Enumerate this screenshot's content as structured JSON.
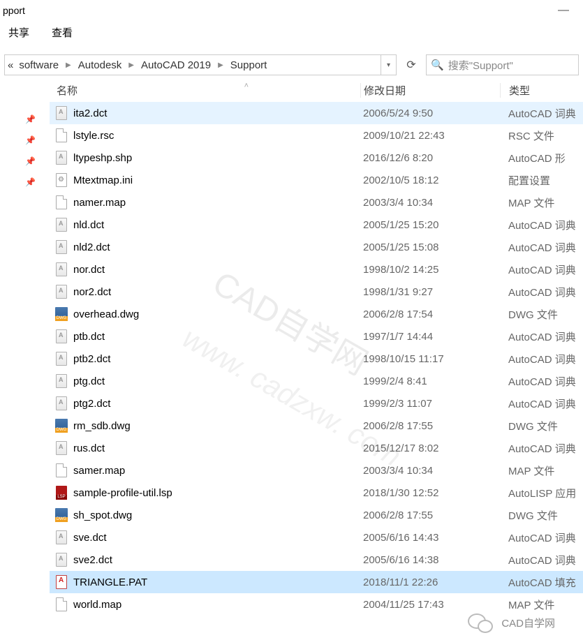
{
  "title_fragment": "pport",
  "toolbar": {
    "share": "共享",
    "view": "查看"
  },
  "breadcrumb": {
    "segs": [
      "software",
      "Autodesk",
      "AutoCAD 2019",
      "Support"
    ]
  },
  "search": {
    "placeholder": "搜索\"Support\""
  },
  "columns": {
    "name": "名称",
    "date": "修改日期",
    "type": "类型"
  },
  "files": [
    {
      "name": "ita2.dct",
      "date": "2006/5/24 9:50",
      "type": "AutoCAD 词典",
      "ico": "dct",
      "sel": "highlight"
    },
    {
      "name": "lstyle.rsc",
      "date": "2009/10/21 22:43",
      "type": "RSC 文件",
      "ico": "blank"
    },
    {
      "name": "ltypeshp.shp",
      "date": "2016/12/6 8:20",
      "type": "AutoCAD 形",
      "ico": "dct"
    },
    {
      "name": "Mtextmap.ini",
      "date": "2002/10/5 18:12",
      "type": "配置设置",
      "ico": "ini"
    },
    {
      "name": "namer.map",
      "date": "2003/3/4 10:34",
      "type": "MAP 文件",
      "ico": "blank"
    },
    {
      "name": "nld.dct",
      "date": "2005/1/25 15:20",
      "type": "AutoCAD 词典",
      "ico": "dct"
    },
    {
      "name": "nld2.dct",
      "date": "2005/1/25 15:08",
      "type": "AutoCAD 词典",
      "ico": "dct"
    },
    {
      "name": "nor.dct",
      "date": "1998/10/2 14:25",
      "type": "AutoCAD 词典",
      "ico": "dct"
    },
    {
      "name": "nor2.dct",
      "date": "1998/1/31 9:27",
      "type": "AutoCAD 词典",
      "ico": "dct"
    },
    {
      "name": "overhead.dwg",
      "date": "2006/2/8 17:54",
      "type": "DWG 文件",
      "ico": "dwg"
    },
    {
      "name": "ptb.dct",
      "date": "1997/1/7 14:44",
      "type": "AutoCAD 词典",
      "ico": "dct"
    },
    {
      "name": "ptb2.dct",
      "date": "1998/10/15 11:17",
      "type": "AutoCAD 词典",
      "ico": "dct"
    },
    {
      "name": "ptg.dct",
      "date": "1999/2/4 8:41",
      "type": "AutoCAD 词典",
      "ico": "dct"
    },
    {
      "name": "ptg2.dct",
      "date": "1999/2/3 11:07",
      "type": "AutoCAD 词典",
      "ico": "dct"
    },
    {
      "name": "rm_sdb.dwg",
      "date": "2006/2/8 17:55",
      "type": "DWG 文件",
      "ico": "dwg"
    },
    {
      "name": "rus.dct",
      "date": "2015/12/17 8:02",
      "type": "AutoCAD 词典",
      "ico": "dct"
    },
    {
      "name": "samer.map",
      "date": "2003/3/4 10:34",
      "type": "MAP 文件",
      "ico": "blank"
    },
    {
      "name": "sample-profile-util.lsp",
      "date": "2018/1/30 12:52",
      "type": "AutoLISP 应用",
      "ico": "lsp"
    },
    {
      "name": "sh_spot.dwg",
      "date": "2006/2/8 17:55",
      "type": "DWG 文件",
      "ico": "dwg"
    },
    {
      "name": "sve.dct",
      "date": "2005/6/16 14:43",
      "type": "AutoCAD 词典",
      "ico": "dct"
    },
    {
      "name": "sve2.dct",
      "date": "2005/6/16 14:38",
      "type": "AutoCAD 词典",
      "ico": "dct"
    },
    {
      "name": "TRIANGLE.PAT",
      "date": "2018/11/1 22:26",
      "type": "AutoCAD 填充",
      "ico": "pat",
      "sel": "selected"
    },
    {
      "name": "world.map",
      "date": "2004/11/25 17:43",
      "type": "MAP 文件",
      "ico": "blank"
    }
  ],
  "watermark": {
    "line1": "CAD自学网",
    "line2": "www. cadzxw. com"
  },
  "footer": {
    "text": "CAD自学网"
  }
}
